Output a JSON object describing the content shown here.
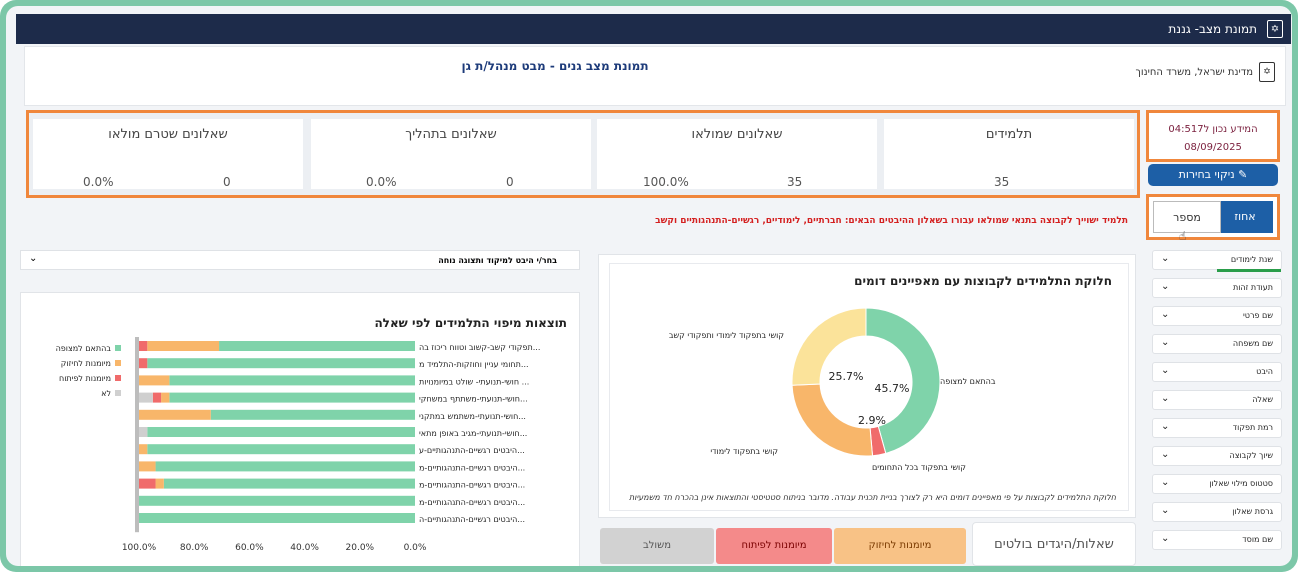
{
  "topbar": {
    "title": "תמונת מצב- גננת",
    "emblem_icon": "menorah-emblem-icon"
  },
  "header": {
    "title": "תמונת מצב גנים - מבט מנהל/ת גן",
    "ministry": "מדינת ישראל, משרד החינוך"
  },
  "stats": [
    {
      "label": "תלמידים",
      "value": "35",
      "percent": ""
    },
    {
      "label": "שאלונים שמולאו",
      "value": "35",
      "percent": "100.0%"
    },
    {
      "label": "שאלונים בתהליך",
      "value": "0",
      "percent": "0.0%"
    },
    {
      "label": "שאלונים שטרם מולאו",
      "value": "0",
      "percent": "0.0%"
    }
  ],
  "info": {
    "line1": "המידע נכון ל04:517",
    "line2": "08/09/2025"
  },
  "clear_button": "ניקוי בחירות",
  "toggle": {
    "percent_label": "אחוז",
    "number_label": "מספר"
  },
  "notice": "תלמיד ישוייך לקבוצה בתנאי שמולאו עבורו בשאלון ההיבטים הבאים: חברתיים, לימודיים, רגשיים-התנהגותיים וקשב",
  "filters": [
    "שנת לימודים",
    "תעודת זהות",
    "שם פרטי",
    "שם משפחה",
    "היבט",
    "שאלה",
    "רמת תפקוד",
    "שיוך לקבוצה",
    "סטטוס מילוי שאלון",
    "גרסת שאלון",
    "שם מוסד"
  ],
  "focus_select": "בחר/י היבט למיקוד ותצוגה נוחה",
  "bar_chart": {
    "title": "תוצאות מיפוי התלמידים לפי שאלה",
    "legend": [
      {
        "label": "בהתאם למצופה",
        "color": "#7fd3aa"
      },
      {
        "label": "מיומנות לחיזוק",
        "color": "#f8b66a"
      },
      {
        "label": "מיומנות לפיתוח",
        "color": "#f06b6b"
      },
      {
        "label": "לא",
        "color": "#d0d0d0"
      }
    ]
  },
  "chart_data": [
    {
      "type": "bar",
      "orientation": "horizontal-stacked",
      "title": "תוצאות מיפוי התלמידים לפי שאלה",
      "categories": [
        "תפקודי קשב-קשוב וטווח ריכוז בה...",
        "תחומי עניין וחוזקות-התלמיד מ...",
        "חושי-תנועתי- שולט במיומנויות ...",
        "חושי-תנועתי-משתתף במשחקי...",
        "חושי-תנועתי-משתמש במתקני...",
        "חושי-תנועתי-מגיב באופן מתאי...",
        "היבטים רגשיים-התנהגותיים-ע...",
        "היבטים רגשיים-התנהגותיים-מ...",
        "היבטים רגשיים-התנהגותיים-מ...",
        "היבטים רגשיים-התנהגותיים-מ...",
        "היבטים רגשיים-התנהגותיים-ה..."
      ],
      "series": [
        {
          "name": "בהתאם למצופה",
          "values": [
            71,
            97,
            89,
            89,
            74,
            97,
            97,
            94,
            91,
            100,
            100
          ],
          "color": "#7fd3aa"
        },
        {
          "name": "מיומנות לחיזוק",
          "values": [
            26,
            0,
            11,
            3,
            26,
            0,
            3,
            6,
            3,
            0,
            0
          ],
          "color": "#f8b66a"
        },
        {
          "name": "מיומנות לפיתוח",
          "values": [
            3,
            3,
            0,
            3,
            0,
            0,
            0,
            0,
            6,
            0,
            0
          ],
          "color": "#f06b6b"
        },
        {
          "name": "לא",
          "values": [
            0,
            0,
            0,
            5,
            0,
            3,
            0,
            0,
            0,
            0,
            0
          ],
          "color": "#cfcfcf"
        }
      ],
      "xticks": [
        "100.0%",
        "80.0%",
        "60.0%",
        "40.0%",
        "20.0%",
        "0.0%"
      ],
      "xlim": [
        0,
        100
      ],
      "x_reversed": true
    },
    {
      "type": "pie",
      "title": "חלוקת התלמידים לקבוצות עם מאפיינים דומים",
      "slices": [
        {
          "label": "בהתאם למצופה",
          "value": 45.7,
          "text": "45.7%",
          "color": "#7fd3aa"
        },
        {
          "label": "קושי בתפקוד בכל התחומים",
          "value": 2.9,
          "text": "2.9%",
          "color": "#f06b6b"
        },
        {
          "label": "קושי בתפקוד לימודי",
          "value": 25.7,
          "text": "",
          "color": "#f8b66a"
        },
        {
          "label": "קושי בתפקוד לימודי ותפקודי קשב",
          "value": 25.7,
          "text": "25.7%",
          "color": "#fbe39a"
        }
      ],
      "note": "חלוקת התלמידים לקבוצות על פי מאפיינים דומים היא רק לצורך בניית תכנית עבודה. מדובר בניתוח סטטיסטי והתוצאות אינן בהכרח חד משמעיות"
    }
  ],
  "bottom_buttons": [
    {
      "label": "מיומנות לחיזוק",
      "color": "#f8c286"
    },
    {
      "label": "מיומנות לפיתוח",
      "color": "#f48a8a"
    },
    {
      "label": "משולב",
      "color": "#d2d2d2"
    }
  ],
  "bullets_title": "שאלות/היגדים בולטים"
}
